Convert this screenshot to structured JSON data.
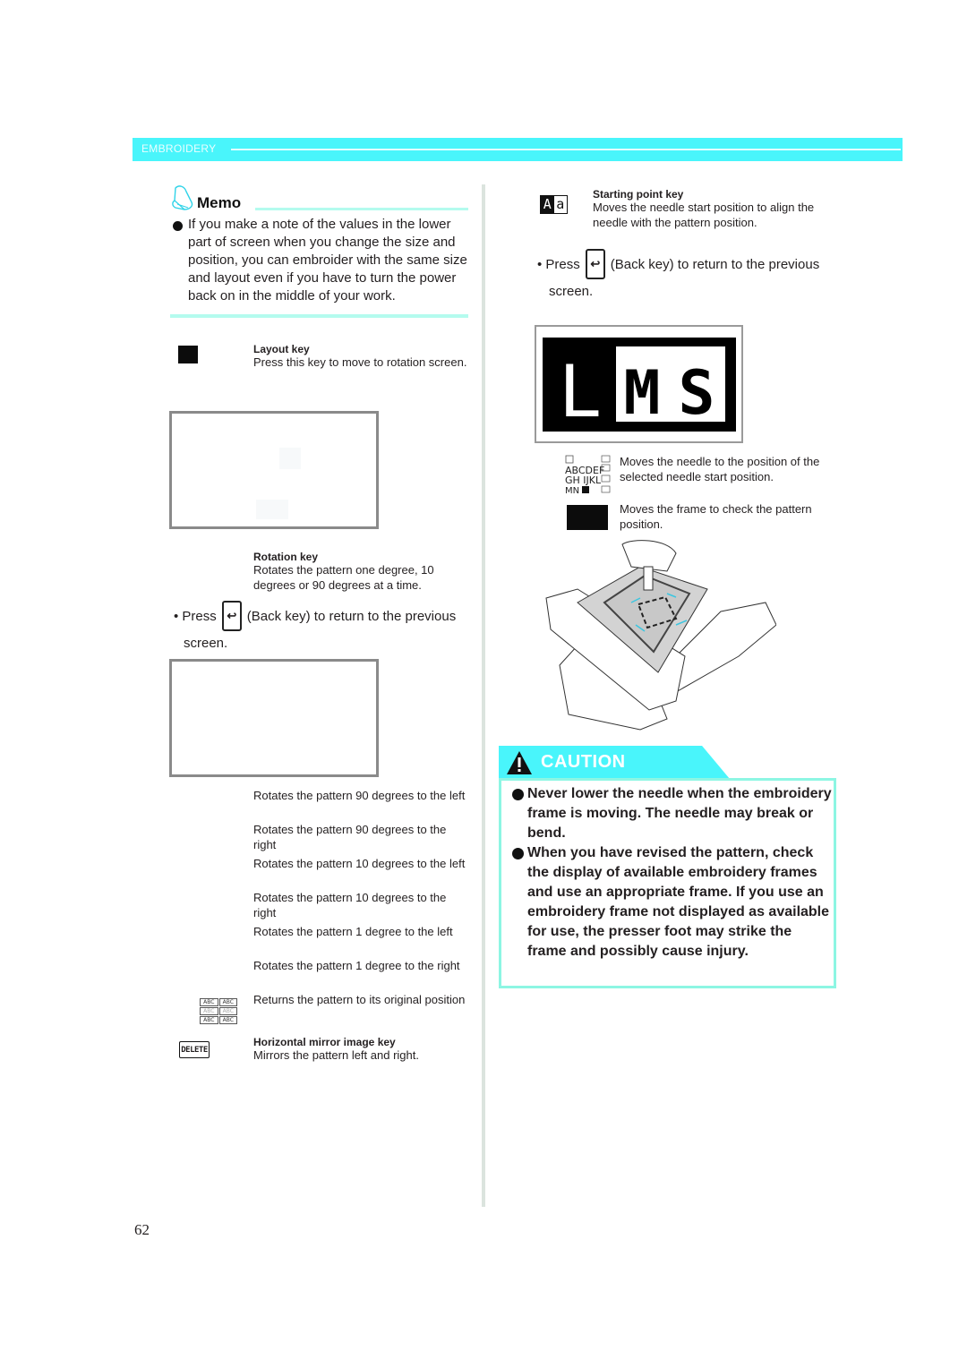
{
  "header": {
    "section_label": "EMBROIDERY",
    "accent_color": "#49f5fb"
  },
  "memo": {
    "title": "Memo",
    "icon": "bell-icon",
    "text": "If you make a note of the values in the lower part of screen when you change the size and position, you can embroider with the same size and layout even if you have to turn the power back on in the middle of your work."
  },
  "left_column": {
    "layout_key": {
      "title": "Layout key",
      "description": "Press this key to move to rotation screen."
    },
    "rotation_key": {
      "title": "Rotation key",
      "description": "Rotates the pattern one degree, 10 degrees or 90 degrees at a time."
    },
    "press_back": {
      "prefix": "Press",
      "back_key_glyph": "↩",
      "suffix": "(Back key) to return to the previous",
      "continuation": "screen."
    },
    "rotation_items": [
      {
        "description": "Rotates the pattern 90 degrees to the left"
      },
      {
        "description": "Rotates the pattern 90 degrees to the right"
      },
      {
        "description": "Rotates the pattern 10 degrees to the left"
      },
      {
        "description": "Rotates the pattern 10 degrees to the right"
      },
      {
        "description": "Rotates the pattern 1 degree to the left"
      },
      {
        "description": "Rotates the pattern 1 degree to the right"
      },
      {
        "description": "Returns the pattern to its original position",
        "icon_cells": [
          "ABC",
          "ABC",
          "ABC",
          "ABC",
          "ABC",
          "ABC"
        ]
      }
    ],
    "mirror_key": {
      "icon_label": "DELETE",
      "title": "Horizontal mirror image key",
      "description": "Mirrors the pattern left and right."
    }
  },
  "right_column": {
    "starting_point_key": {
      "icon_text": [
        "A",
        "a"
      ],
      "title": "Starting point key",
      "description": "Moves the needle start position to align the needle with the pattern position."
    },
    "press_back": {
      "prefix": "Press",
      "back_key_glyph": "↩",
      "suffix": "(Back key) to return to the previous",
      "continuation": "screen."
    },
    "lms_display": {
      "letters": [
        "L",
        "M",
        "S"
      ],
      "selected": "L"
    },
    "needle_position": {
      "description": "Moves the needle to the position of the selected needle start position."
    },
    "frame_check": {
      "description": "Moves the frame to check the pattern position."
    }
  },
  "caution": {
    "title": "CAUTION",
    "items": [
      "Never lower the needle when the embroidery frame is moving. The needle may break or bend.",
      "When you have revised the pattern, check the display of available embroidery frames and use an appropriate frame. If you use an embroidery frame not displayed as available for use, the presser foot may strike the frame and possibly cause injury."
    ]
  },
  "page_number": "62"
}
